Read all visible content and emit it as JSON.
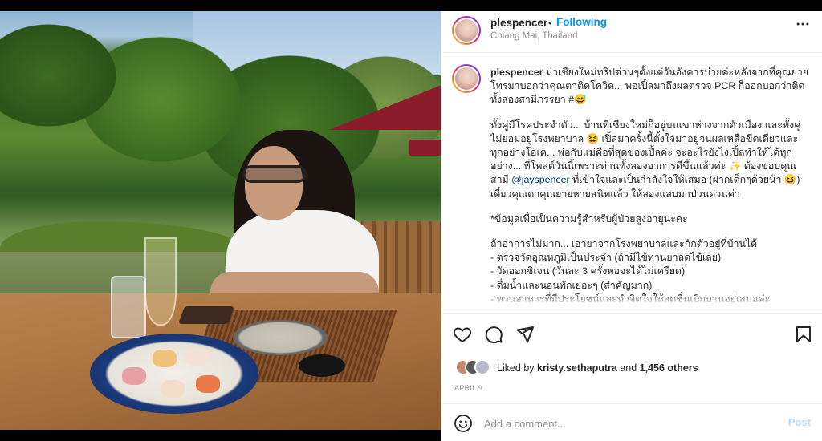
{
  "post": {
    "username": "plespencer",
    "dot": "•",
    "follow_label": "Following",
    "location": "Chiang Mai, Thailand",
    "more_label": "•••"
  },
  "caption": {
    "username": "plespencer",
    "p1": "มาเชียงใหม่ทริปด่วนๆตั้งแต่วันอังคารบ่ายค่ะหลังจากที่คุณยายโทรมาบอกว่าคุณตาติดโควิด... พอเปิ้ลมาถึงผลตรวจ PCR ก็ออกบอกว่าติดทั้งสองสามีภรรยา #😅",
    "p2a": "ทั้งคู่มีโรคประจำตัว... บ้านที่เชียงใหม่ก็อยู่บนเขาห่างจากตัวเมือง และทั้งคู่ไม่ยอมอยู่โรงพยาบาล 😆 เปิ้ลมาครั้งนี้ตั้งใจมาอยู่จนผลเหลือขีดเดียวและทุกอย่างโอเค... พ่อกับแม่คือที่สุดของเปิ้ลค่ะ จะอะไรยังไงเปิ้ลทำให้ได้ทุกอย่าง... ที่โพสต์วันนี้เพราะท่านทั้งสองอาการดีขึ้นแล้วค่ะ ✨ ต้องขอบคุณสามี ",
    "mention": "@jayspencer",
    "p2b": " ที่เข้าใจและเป็นกำลังใจให้เสมอ (ฝากเด็กๆด้วยน้า 😆) เดี๋ยวคุณตาคุณยายหายสนิทแล้ว ให้สองแสบมาป่วนด่วนค่า",
    "p3": "*ข้อมูลเพื่อเป็นความรู้สำหรับผู้ป่วยสูงอายุนะคะ",
    "p4": "ถ้าอาการไม่มาก... เอายาจากโรงพยาบาลและกักตัวอยู่ที่บ้านได้\n- ตรวจวัดอุณหภูมิเป็นประจำ (ถ้ามีไข้ทานยาลดไข้เลย)\n- วัดออกซิเจน (วันละ 3 ครั้งพอจะได้ไม่เครียด)\n- ดื่มน้ำและนอนพักเยอะๆ (สำคัญมาก)\n- ทานอาหารที่มีประโยชน์และทำจิตใจให้สดชื่นเบิกบานอยู่เสมอค่ะ"
  },
  "likes": {
    "prefix": "Liked by ",
    "user": "kristy.sethaputra",
    "middle": " and ",
    "count": "1,456 others"
  },
  "date": "APRIL 9",
  "comment": {
    "placeholder": "Add a comment...",
    "post_label": "Post"
  },
  "icons": {
    "like": "heart-icon",
    "comment": "comment-icon",
    "share": "paper-plane-icon",
    "save": "bookmark-icon",
    "emoji": "smiley-icon",
    "more": "more-icon"
  },
  "colors": {
    "accent": "#0095f6",
    "post_disabled": "#b3dbff",
    "muted": "#8e8e8e",
    "mention": "#00376b"
  }
}
